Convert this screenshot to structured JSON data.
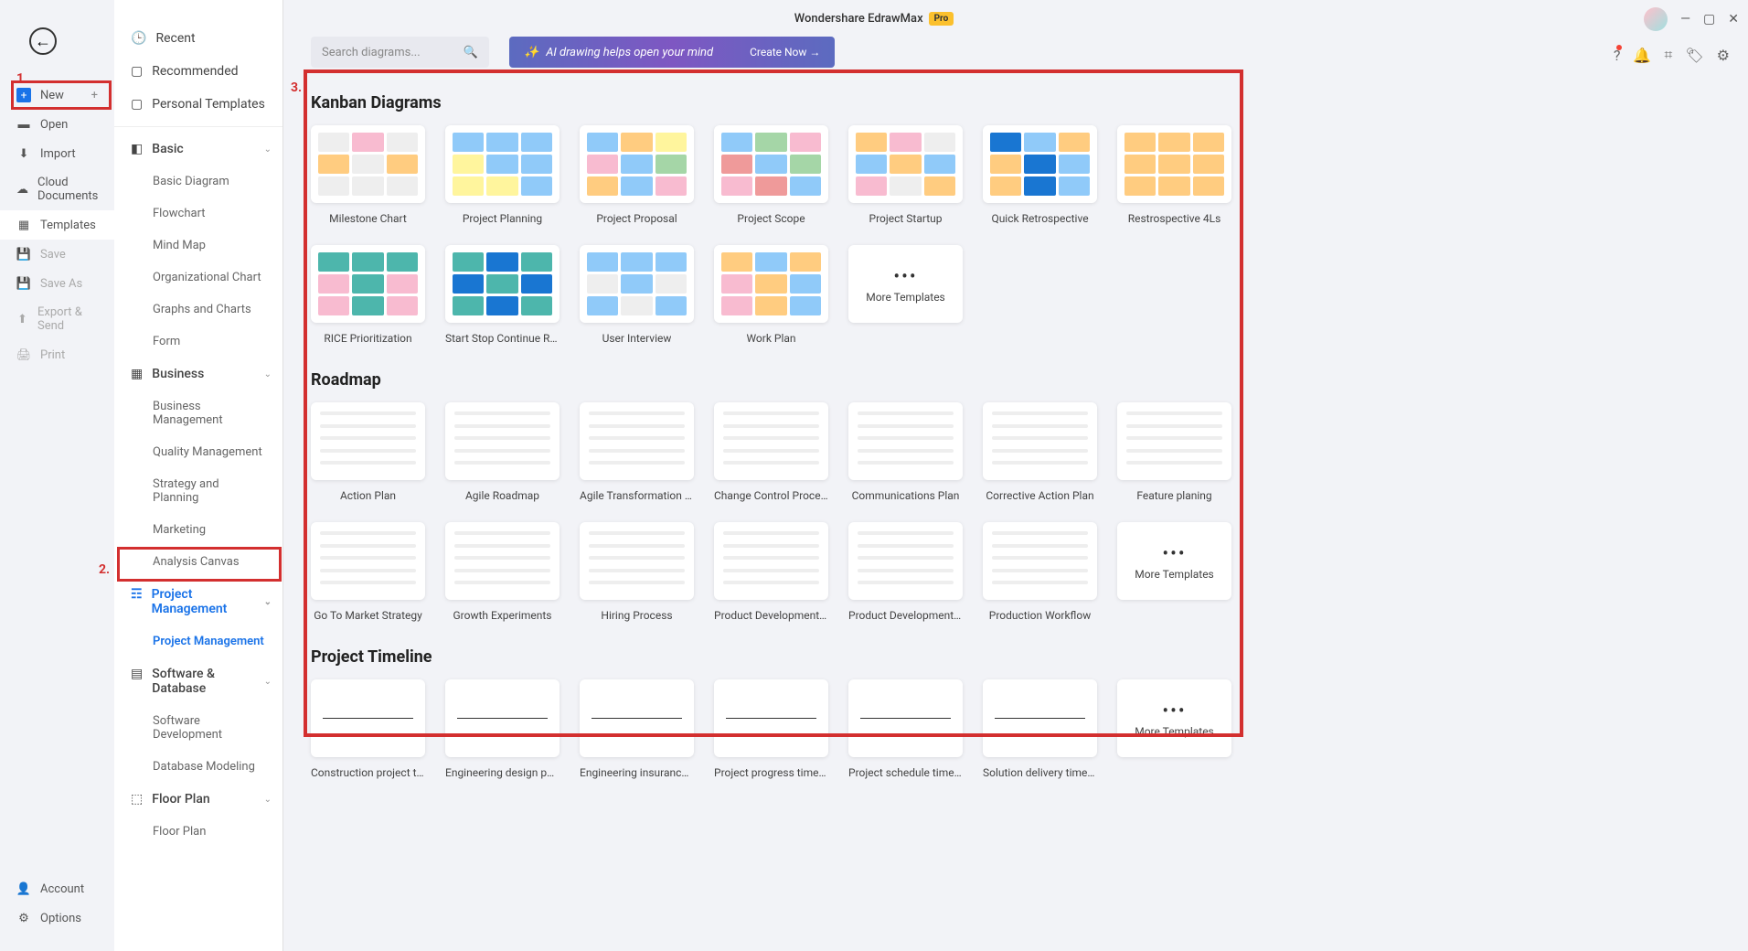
{
  "app": {
    "title": "Wondershare EdrawMax",
    "badge": "Pro"
  },
  "annotations": {
    "a1": "1.",
    "a2": "2.",
    "a3": "3."
  },
  "leftRail": {
    "new": "New",
    "open": "Open",
    "import": "Import",
    "cloudDocs": "Cloud Documents",
    "templates": "Templates",
    "save": "Save",
    "saveAs": "Save As",
    "exportSend": "Export & Send",
    "print": "Print",
    "account": "Account",
    "options": "Options"
  },
  "categories": {
    "recent": "Recent",
    "recommended": "Recommended",
    "personal": "Personal Templates",
    "basic": "Basic",
    "basicItems": [
      "Basic Diagram",
      "Flowchart",
      "Mind Map",
      "Organizational Chart",
      "Graphs and Charts",
      "Form"
    ],
    "business": "Business",
    "businessItems": [
      "Business Management",
      "Quality Management",
      "Strategy and Planning",
      "Marketing",
      "Analysis Canvas"
    ],
    "projectMgmt": "Project Management",
    "projectMgmtItems": [
      "Project Management"
    ],
    "software": "Software & Database",
    "softwareItems": [
      "Software Development",
      "Database Modeling"
    ],
    "floorPlan": "Floor Plan",
    "floorPlanItems": [
      "Floor Plan"
    ]
  },
  "search": {
    "placeholder": "Search diagrams..."
  },
  "aiBanner": {
    "text": "AI drawing helps open your mind",
    "cta": "Create Now →"
  },
  "sections": [
    {
      "title": "Kanban Diagrams",
      "templates": [
        "Milestone Chart",
        "Project Planning",
        "Project Proposal",
        "Project Scope",
        "Project Startup",
        "Quick Retrospective",
        "Restrospective 4Ls",
        "RICE Prioritization",
        "Start Stop Continue Retros...",
        "User Interview",
        "Work Plan"
      ],
      "more": "More Templates"
    },
    {
      "title": "Roadmap",
      "templates": [
        "Action Plan",
        "Agile Roadmap",
        "Agile Transformation Road...",
        "Change Control Process",
        "Communications Plan",
        "Corrective Action Plan",
        "Feature planing",
        "Go To Market Strategy",
        "Growth Experiments",
        "Hiring Process",
        "Product Development Roa...",
        "Product Development Roa...",
        "Production Workflow"
      ],
      "more": "More Templates"
    },
    {
      "title": "Project Timeline",
      "templates": [
        "Construction project timeli...",
        "Engineering design phase t...",
        "Engineering insurance effe...",
        "Project progress timeline",
        "Project schedule timeline",
        "Solution delivery timeline"
      ],
      "more": "More Templates"
    }
  ]
}
